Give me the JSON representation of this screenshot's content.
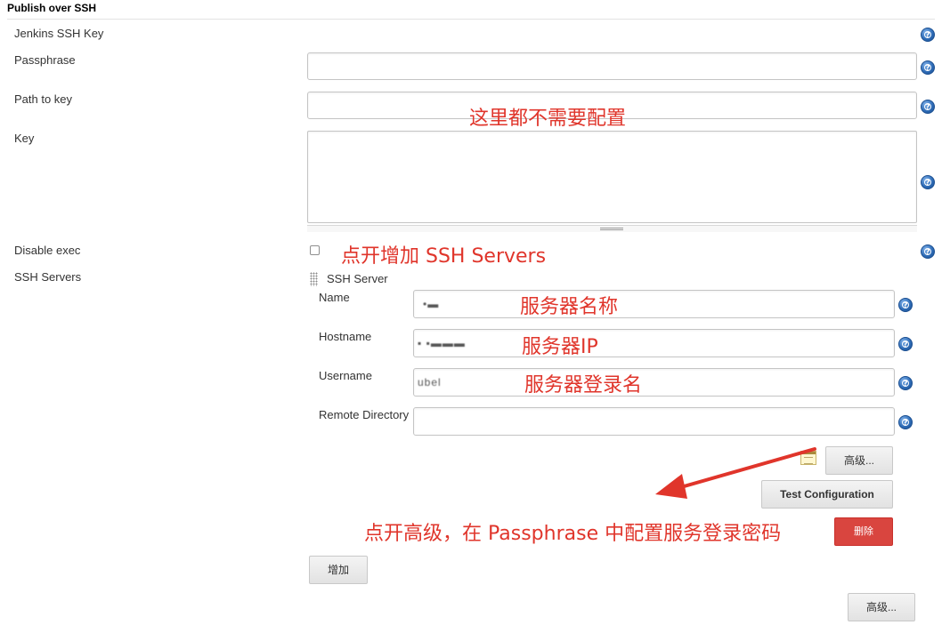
{
  "section": {
    "title": "Publish over SSH"
  },
  "fields": {
    "jenkins_ssh_key_label": "Jenkins SSH Key",
    "passphrase_label": "Passphrase",
    "passphrase_value": "",
    "path_to_key_label": "Path to key",
    "path_to_key_value": "",
    "key_label": "Key",
    "key_value": "",
    "disable_exec_label": "Disable exec",
    "ssh_servers_label": "SSH Servers"
  },
  "ssh_server": {
    "heading": "SSH Server",
    "name_label": "Name",
    "name_value": "•▬",
    "hostname_label": "Hostname",
    "hostname_value": "▪      ▪▬▬▬",
    "username_label": "Username",
    "username_value": "ubel",
    "remote_directory_label": "Remote Directory",
    "remote_directory_value": ""
  },
  "buttons": {
    "advanced_label": "高级...",
    "test_configuration_label": "Test Configuration",
    "delete_label": "删除",
    "add_label": "增加",
    "advanced_bottom_label": "高级..."
  },
  "help_icon_glyph": "?",
  "annotations": {
    "no_config_needed": "这里都不需要配置",
    "open_add_servers": "点开增加 SSH Servers",
    "server_name": "服务器名称",
    "server_ip": "服务器IP",
    "server_login_name": "服务器登录名",
    "open_advanced": "点开高级，在 Passphrase 中配置服务登录密码"
  },
  "colors": {
    "annotation_red": "#e0352b",
    "delete_button_red": "#d9453f",
    "help_blue": "#2f6db8"
  }
}
